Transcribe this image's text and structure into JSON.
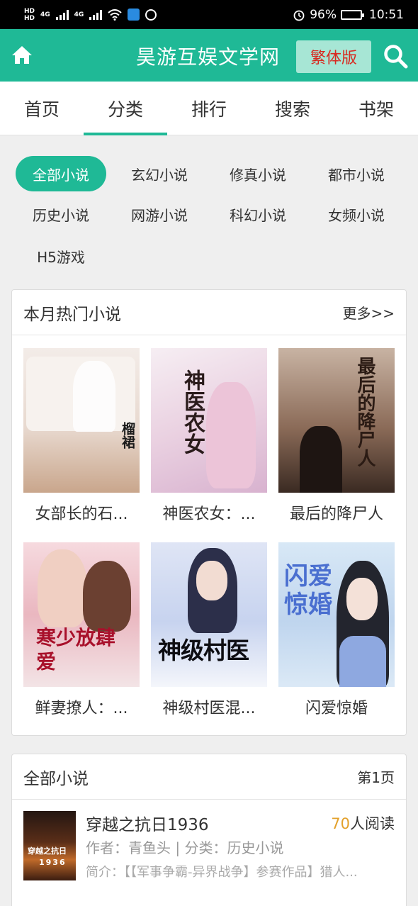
{
  "status_bar": {
    "hd1": "HD",
    "hd2": "HD",
    "net1": "4G",
    "net2": "4G",
    "battery": "96%",
    "battery_level": 0.96,
    "time": "10:51"
  },
  "header": {
    "title": "昊游互娱文学网",
    "traditional_button": "繁体版"
  },
  "nav_tabs": [
    "首页",
    "分类",
    "排行",
    "搜索",
    "书架"
  ],
  "active_tab": 1,
  "categories": [
    "全部小说",
    "玄幻小说",
    "修真小说",
    "都市小说",
    "历史小说",
    "网游小说",
    "科幻小说",
    "女频小说",
    "H5游戏"
  ],
  "active_category": 0,
  "hot": {
    "title": "本月热门小说",
    "more": "更多>>",
    "books": [
      {
        "name": "女部长的石...",
        "cover_text": "女部長的石榴裙",
        "cover_color": "#e9dcd4"
      },
      {
        "name": "神医农女：...",
        "cover_text": "神医农女",
        "cover_color": "#efd9e4"
      },
      {
        "name": "最后的降尸人",
        "cover_text": "最后的降尸人",
        "cover_color": "#8a6a55"
      },
      {
        "name": "鲜妻撩人：...",
        "cover_text": "寒少放肆爱",
        "cover_color": "#f1c9cf"
      },
      {
        "name": "神级村医混...",
        "cover_text": "神级村医",
        "cover_color": "#cfd8f2"
      },
      {
        "name": "闪爱惊婚",
        "cover_text": "闪爱惊婚",
        "cover_color": "#c9def0"
      }
    ]
  },
  "all": {
    "title": "全部小说",
    "page": "第1页",
    "items": [
      {
        "title": "穿越之抗日1936",
        "readers_num": "70",
        "readers_suffix": "人阅读",
        "meta": "作者：青鱼头 | 分类：历史小说",
        "intro": "简介：【【军事争霸-异界战争】参赛作品】猎人...",
        "cover_text": "穿越之抗日",
        "cover_year": "1936"
      }
    ]
  },
  "colors": {
    "accent": "#1fb996",
    "trad_text": "#d8281f",
    "readers_num": "#e3a12b"
  },
  "icons": [
    "home-icon",
    "search-icon",
    "signal-icon",
    "wifi-icon",
    "alarm-icon",
    "battery-icon"
  ]
}
